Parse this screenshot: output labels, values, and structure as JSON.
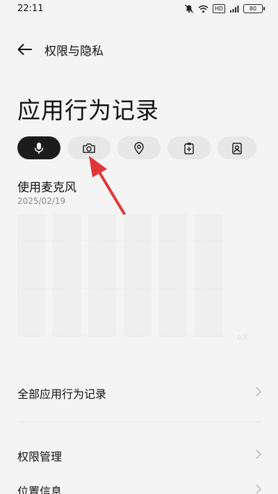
{
  "status_bar": {
    "time": "22:11",
    "battery": "80",
    "hd_label": "HD",
    "icons": [
      "mute-bell-icon",
      "wifi-icon",
      "hd-icon",
      "signal-icon",
      "battery-icon"
    ]
  },
  "header": {
    "back_icon": "back-arrow-icon",
    "title": "权限与隐私"
  },
  "page_title": "应用行为记录",
  "categories": [
    {
      "icon": "microphone-icon",
      "active": true
    },
    {
      "icon": "camera-icon",
      "active": false
    },
    {
      "icon": "location-pin-icon",
      "active": false
    },
    {
      "icon": "clipboard-plus-icon",
      "active": false
    },
    {
      "icon": "contact-card-icon",
      "active": false
    }
  ],
  "usage": {
    "title": "使用麦克风",
    "date": "2025/02/19",
    "axis_label": "0次"
  },
  "list": [
    {
      "label": "全部应用行为记录"
    },
    {
      "label": "权限管理"
    },
    {
      "label": "位置信息"
    }
  ],
  "colors": {
    "background": "#f4f4f4",
    "active_pill": "#1c1c1c",
    "inactive_pill": "#e7e7e7",
    "annotation_arrow": "#e0363a"
  }
}
